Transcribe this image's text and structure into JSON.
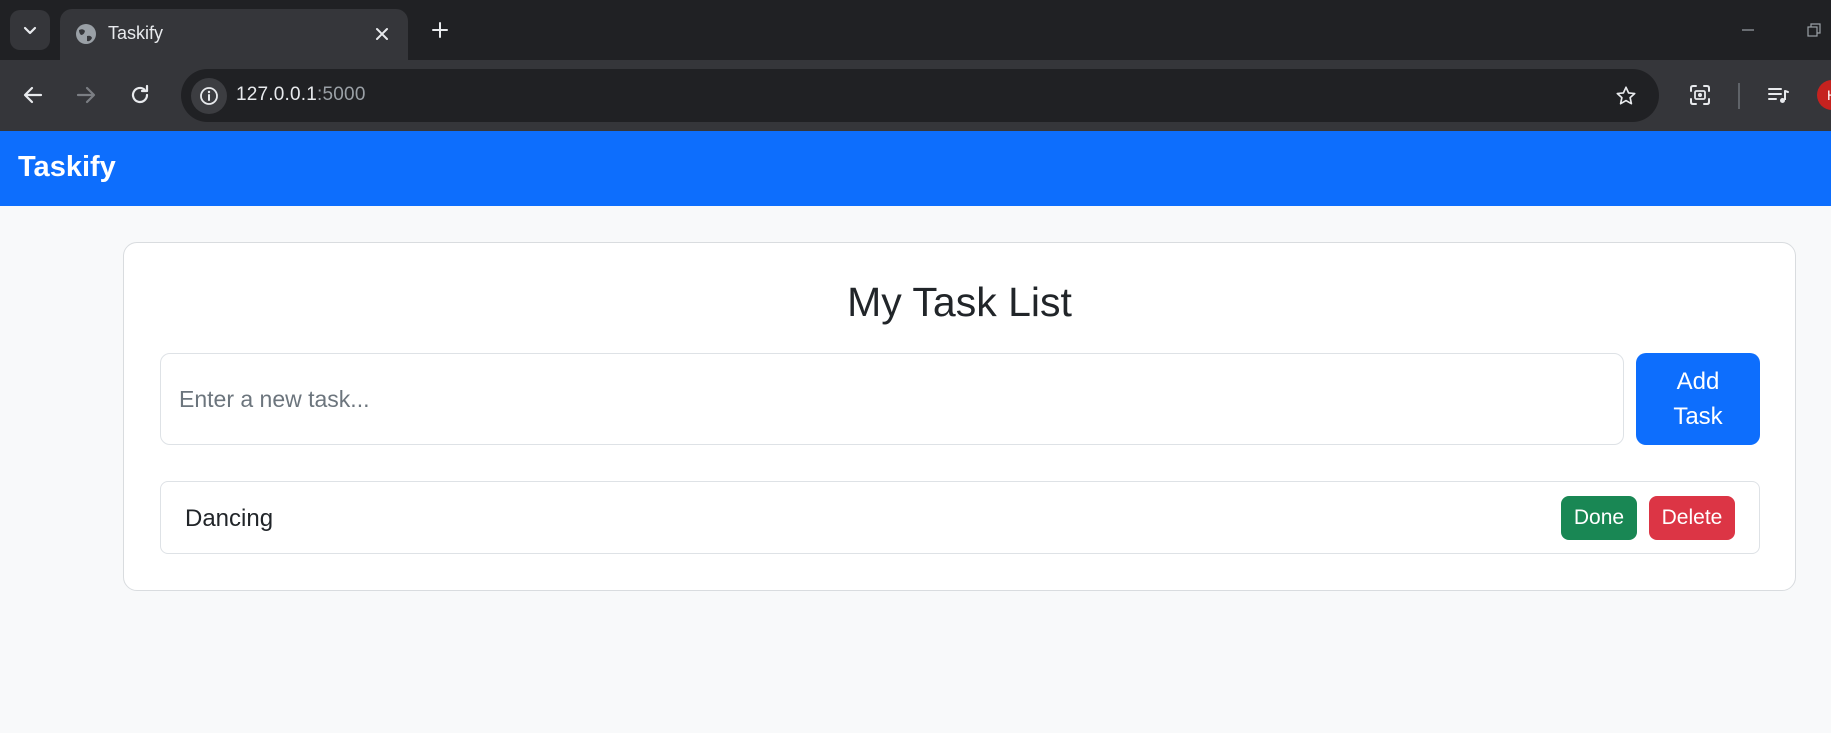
{
  "browser": {
    "tab": {
      "title": "Taskify",
      "favicon": "globe-icon"
    },
    "address_bar": {
      "host": "127.0.0.1",
      "port": ":5000"
    },
    "profile_initial": "H",
    "icons": [
      "chevron-down-icon",
      "close-icon",
      "plus-icon",
      "back-arrow-icon",
      "forward-arrow-icon",
      "reload-icon",
      "info-icon",
      "star-icon",
      "lens-icon",
      "media-control-icon",
      "minimize-icon",
      "restore-icon"
    ]
  },
  "navbar": {
    "brand": "Taskify",
    "color": "#0d6efd"
  },
  "main": {
    "title": "My Task List",
    "input": {
      "placeholder": "Enter a new task...",
      "value": ""
    },
    "add_button": "Add Task",
    "tasks": [
      {
        "text": "Dancing",
        "done_label": "Done",
        "delete_label": "Delete"
      }
    ]
  },
  "colors": {
    "primary": "#0d6efd",
    "success": "#198754",
    "danger": "#dc3545",
    "page_bg": "#f8f9fa"
  }
}
